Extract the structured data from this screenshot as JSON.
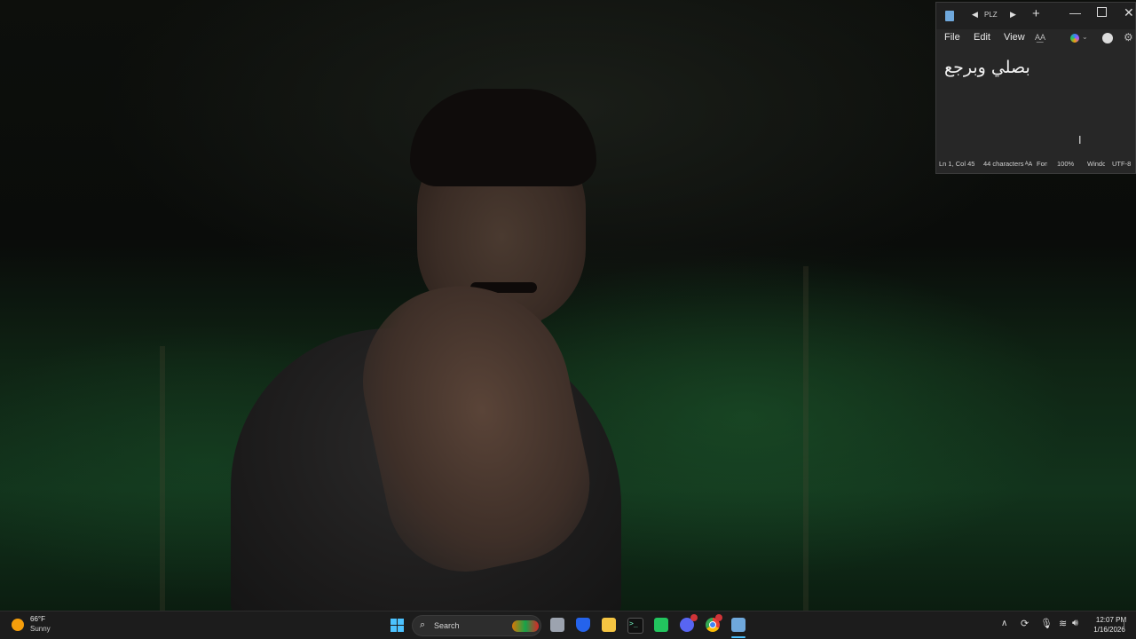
{
  "notepad": {
    "tab_title": "PLZ",
    "menu": {
      "file": "File",
      "edit": "Edit",
      "view": "View"
    },
    "editor_text": "بصلي وبرجع",
    "status": {
      "position": "Ln 1, Col 45",
      "characters": "44 characters",
      "font": "Font",
      "zoom": "100%",
      "line_ending": "Windows (CRLF)",
      "encoding": "UTF-8"
    }
  },
  "taskbar": {
    "weather": {
      "temperature": "66°F",
      "condition": "Sunny",
      "icon": "sun-icon"
    },
    "search_label": "Search",
    "clock": {
      "time": "12:07 PM",
      "date": "1/16/2026"
    },
    "pinned_apps": [
      "task-view",
      "windows-security",
      "file-explorer",
      "terminal",
      "xbox",
      "discord",
      "chrome",
      "notepad"
    ]
  },
  "colors": {
    "accent": "#4cc2ff",
    "taskbar_bg": "#1c1c1c",
    "notepad_bg": "#272727"
  }
}
